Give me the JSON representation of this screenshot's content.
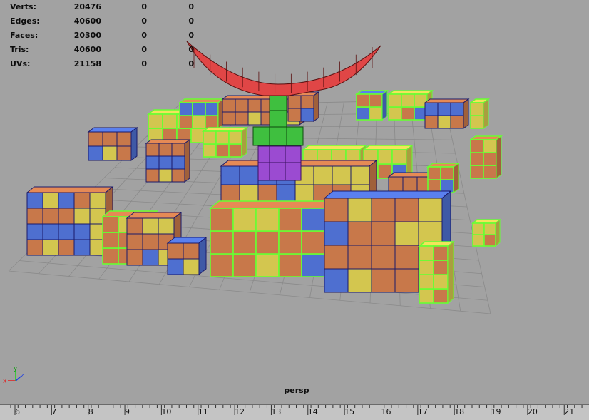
{
  "hud": {
    "rows": [
      {
        "label": "Verts:",
        "v1": "20476",
        "v2": "0",
        "v3": "0"
      },
      {
        "label": "Edges:",
        "v1": "40600",
        "v2": "0",
        "v3": "0"
      },
      {
        "label": "Faces:",
        "v1": "20300",
        "v2": "0",
        "v3": "0"
      },
      {
        "label": "Tris:",
        "v1": "40600",
        "v2": "0",
        "v3": "0"
      },
      {
        "label": "UVs:",
        "v1": "21158",
        "v2": "0",
        "v3": "0"
      }
    ]
  },
  "viewport": {
    "camera": "persp",
    "axis": {
      "x": "x",
      "y": "y",
      "z": "z"
    }
  },
  "timeline": {
    "ticks": [
      "6",
      "7",
      "8",
      "9",
      "10",
      "11",
      "12",
      "13",
      "14",
      "15",
      "16",
      "17",
      "18",
      "19",
      "20",
      "21"
    ]
  },
  "colors": {
    "background": "#a2a2a2",
    "orange": "#c8784a",
    "yellow": "#d3c64f",
    "blue": "#4e6fd0",
    "green": "#3fbf3f",
    "purple": "#9b4bd1",
    "red": "#e04646",
    "wire": "#1a1a6a",
    "selection": "#66ff33"
  }
}
